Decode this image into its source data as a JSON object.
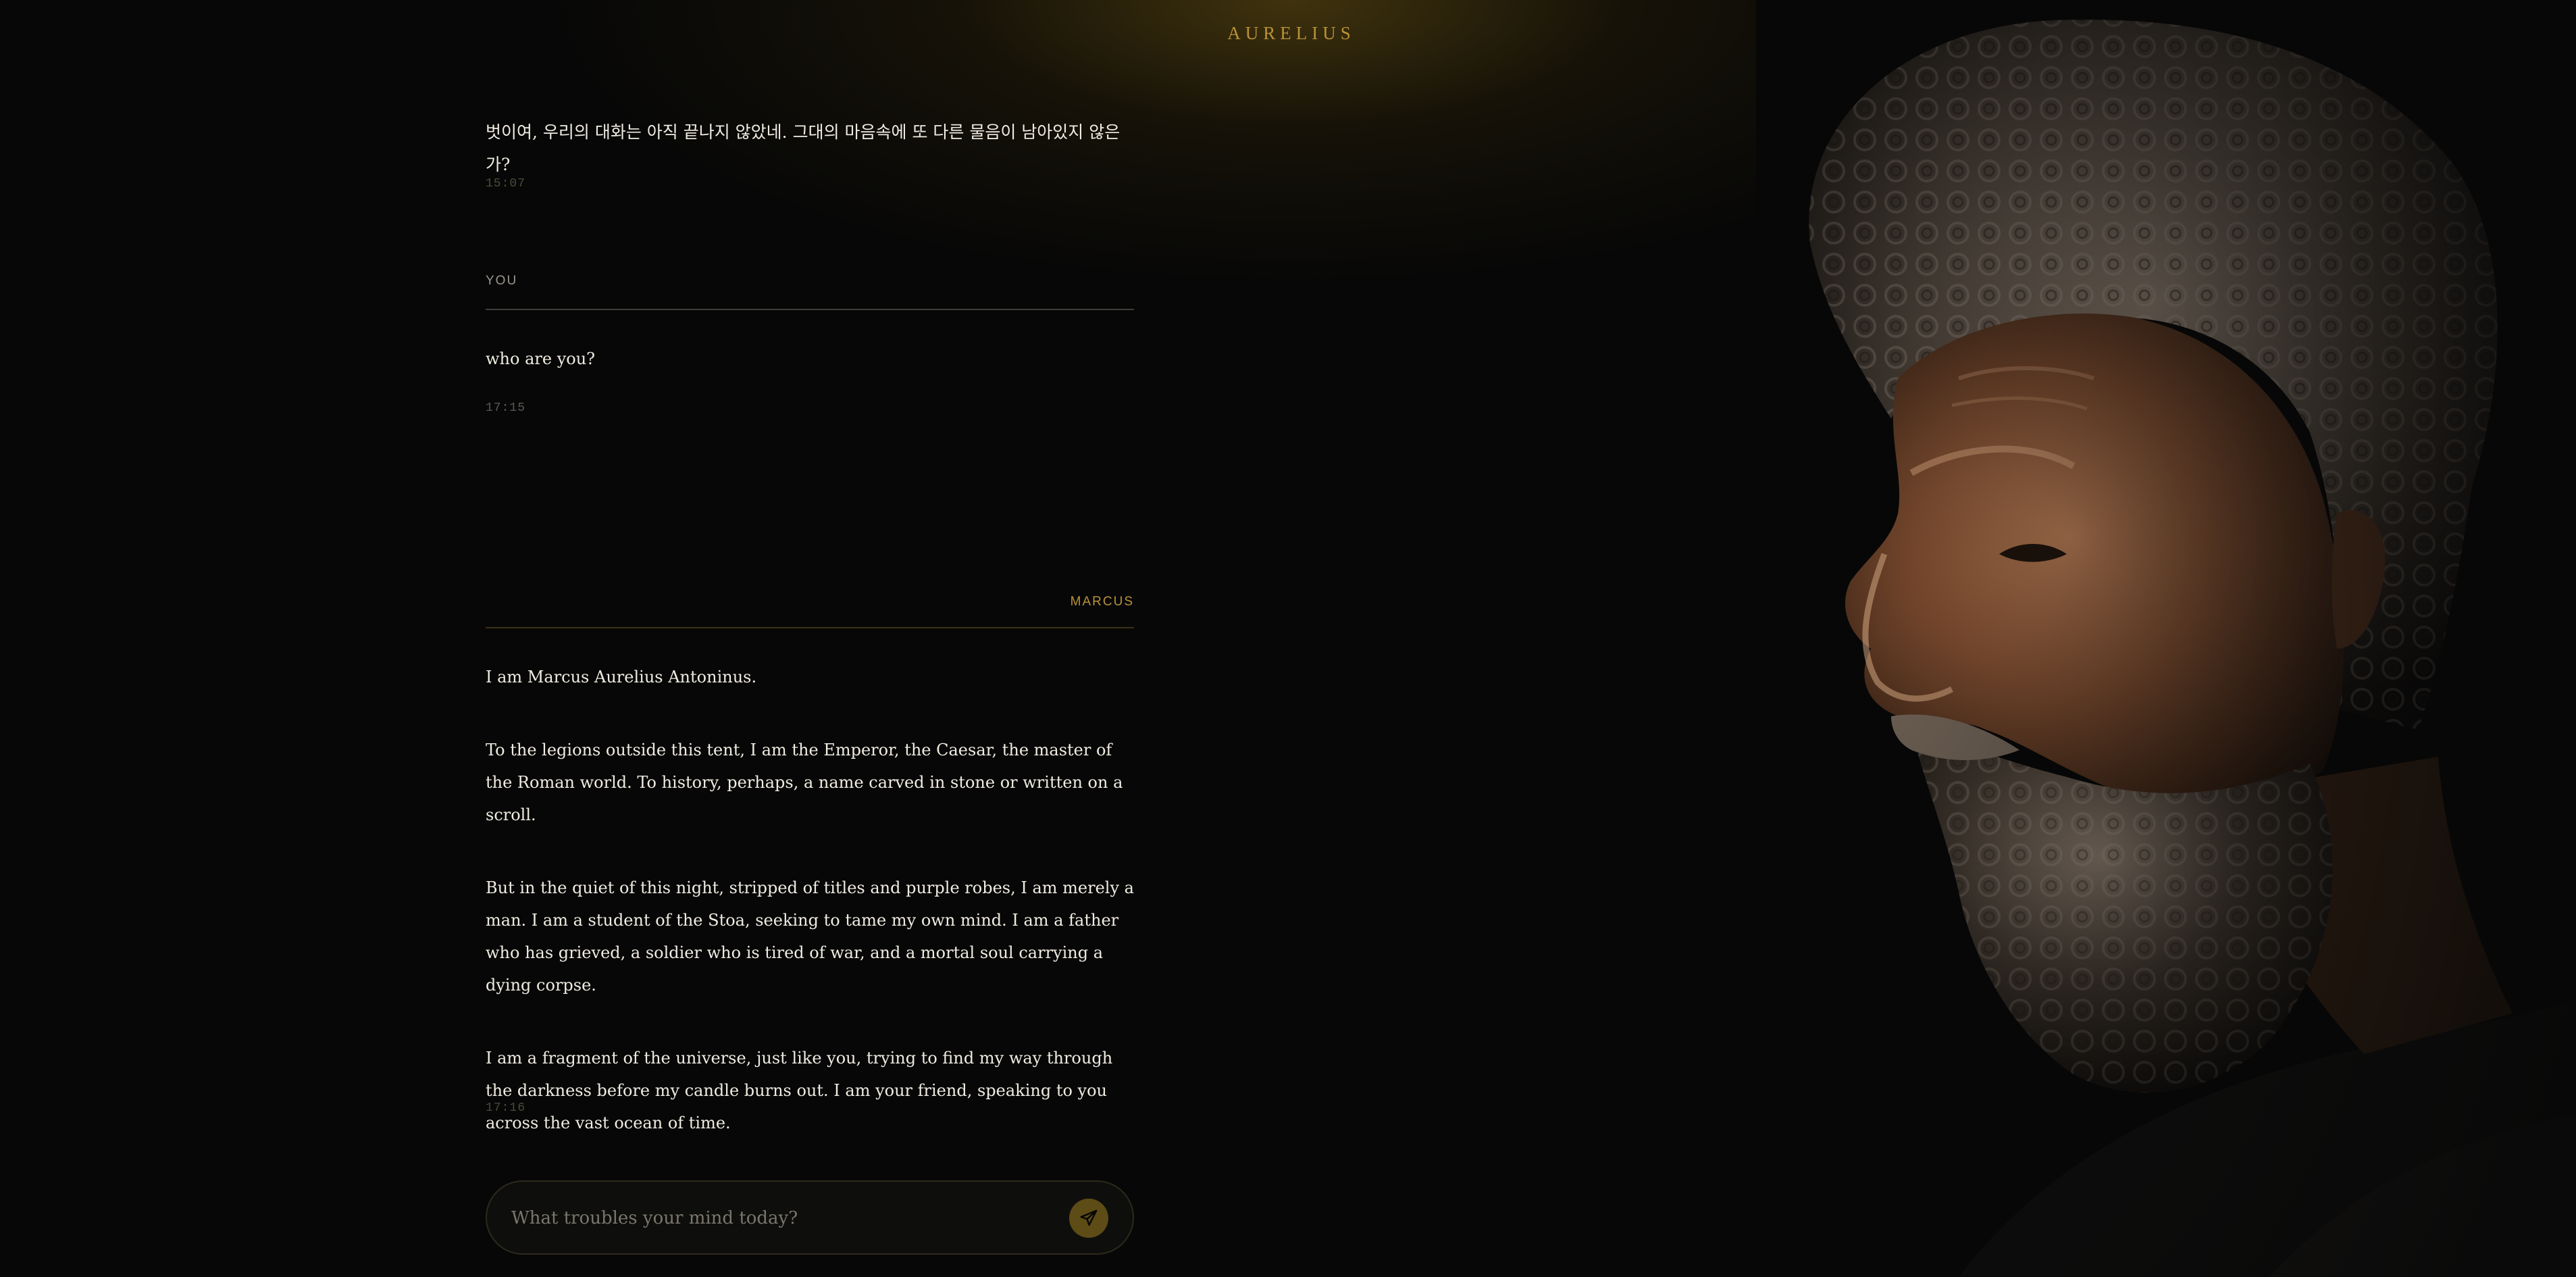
{
  "app": {
    "title": "AURELIUS"
  },
  "messages": [
    {
      "sender": "",
      "text": "벗이여, 우리의 대화는 아직 끝나지 않았네. 그대의 마음속에 또 다른 물음이 남아있지 않은가?",
      "time": "15:07"
    },
    {
      "sender": "YOU",
      "text": "who are you?",
      "time": "17:15"
    },
    {
      "sender": "MARCUS",
      "paragraphs": [
        "I am Marcus Aurelius Antoninus.",
        "To the legions outside this tent, I am the Emperor, the Caesar, the master of the Roman world. To history, perhaps, a name carved in stone or written on a scroll.",
        "But in the quiet of this night, stripped of titles and purple robes, I am merely a man. I am a student of the Stoa, seeking to tame my own mind. I am a father who has grieved, a soldier who is tired of war, and a mortal soul carrying a dying corpse.",
        "I am a fragment of the universe, just like you, trying to find my way through the darkness before my candle burns out. I am your friend, speaking to you across the vast ocean of time."
      ],
      "time": "17:16"
    }
  ],
  "composer": {
    "placeholder": "What troubles your mind today?",
    "send_icon": "send-icon"
  },
  "portrait": {
    "subject": "bust of Marcus Aurelius"
  },
  "colors": {
    "background": "#070707",
    "accent_gold": "#b99237",
    "text": "#f0ece2",
    "send_button": "#5e4c16"
  }
}
